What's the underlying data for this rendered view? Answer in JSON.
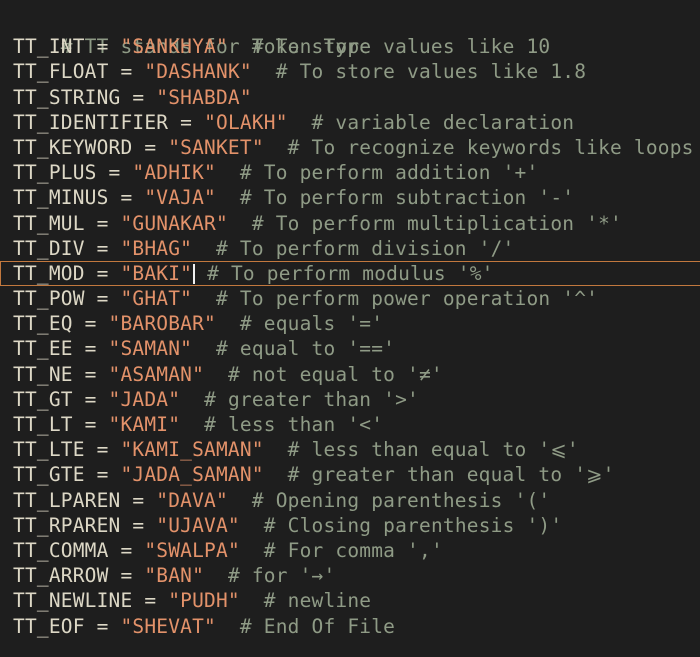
{
  "editor": {
    "header_comment": "# TT stands for Token Type",
    "current_line_index": 9,
    "lines": [
      {
        "name": "TT_INT",
        "value": "\"SANKHYA\"",
        "comment": "# To store values like 10"
      },
      {
        "name": "TT_FLOAT",
        "value": "\"DASHANK\"",
        "comment": "# To store values like 1.8"
      },
      {
        "name": "TT_STRING",
        "value": "\"SHABDA\"",
        "comment": ""
      },
      {
        "name": "TT_IDENTIFIER",
        "value": "\"OLAKH\"",
        "comment": "# variable declaration"
      },
      {
        "name": "TT_KEYWORD",
        "value": "\"SANKET\"",
        "comment": "# To recognize keywords like loops"
      },
      {
        "name": "TT_PLUS",
        "value": "\"ADHIK\"",
        "comment": "# To perform addition '+'"
      },
      {
        "name": "TT_MINUS",
        "value": "\"VAJA\"",
        "comment": "# To perform subtraction '-'"
      },
      {
        "name": "TT_MUL",
        "value": "\"GUNAKAR\"",
        "comment": "# To perform multiplication '*'"
      },
      {
        "name": "TT_DIV",
        "value": "\"BHAG\"",
        "comment": "# To perform division '/'"
      },
      {
        "name": "TT_MOD",
        "value": "\"BAKI\"",
        "comment": "# To perform modulus '%'"
      },
      {
        "name": "TT_POW",
        "value": "\"GHAT\"",
        "comment": "# To perform power operation '^'"
      },
      {
        "name": "TT_EQ",
        "value": "\"BAROBAR\"",
        "comment": "# equals '='"
      },
      {
        "name": "TT_EE",
        "value": "\"SAMAN\"",
        "comment": "# equal to '=='"
      },
      {
        "name": "TT_NE",
        "value": "\"ASAMAN\"",
        "comment": "# not equal to '≠'"
      },
      {
        "name": "TT_GT",
        "value": "\"JADA\"",
        "comment": "# greater than '>'"
      },
      {
        "name": "TT_LT",
        "value": "\"KAMI\"",
        "comment": "# less than '<'"
      },
      {
        "name": "TT_LTE",
        "value": "\"KAMI_SAMAN\"",
        "comment": "# less than equal to '⩽'"
      },
      {
        "name": "TT_GTE",
        "value": "\"JADA_SAMAN\"",
        "comment": "# greater than equal to '⩾'"
      },
      {
        "name": "TT_LPAREN",
        "value": "\"DAVA\"",
        "comment": "# Opening parenthesis '('"
      },
      {
        "name": "TT_RPAREN",
        "value": "\"UJAVA\"",
        "comment": "# Closing parenthesis ')'"
      },
      {
        "name": "TT_COMMA",
        "value": "\"SWALPA\"",
        "comment": "# For comma ','"
      },
      {
        "name": "TT_ARROW",
        "value": "\"BAN\"",
        "comment": "# for '→'"
      },
      {
        "name": "TT_NEWLINE",
        "value": "\"PUDH\"",
        "comment": "# newline"
      },
      {
        "name": "TT_EOF",
        "value": "\"SHEVAT\"",
        "comment": "# End Of File"
      }
    ]
  },
  "colors": {
    "background": "#1e1e1e",
    "identifier": "#ddd8c6",
    "string": "#e3926a",
    "comment": "#8f9b86",
    "current_line_border": "#c2783e"
  }
}
